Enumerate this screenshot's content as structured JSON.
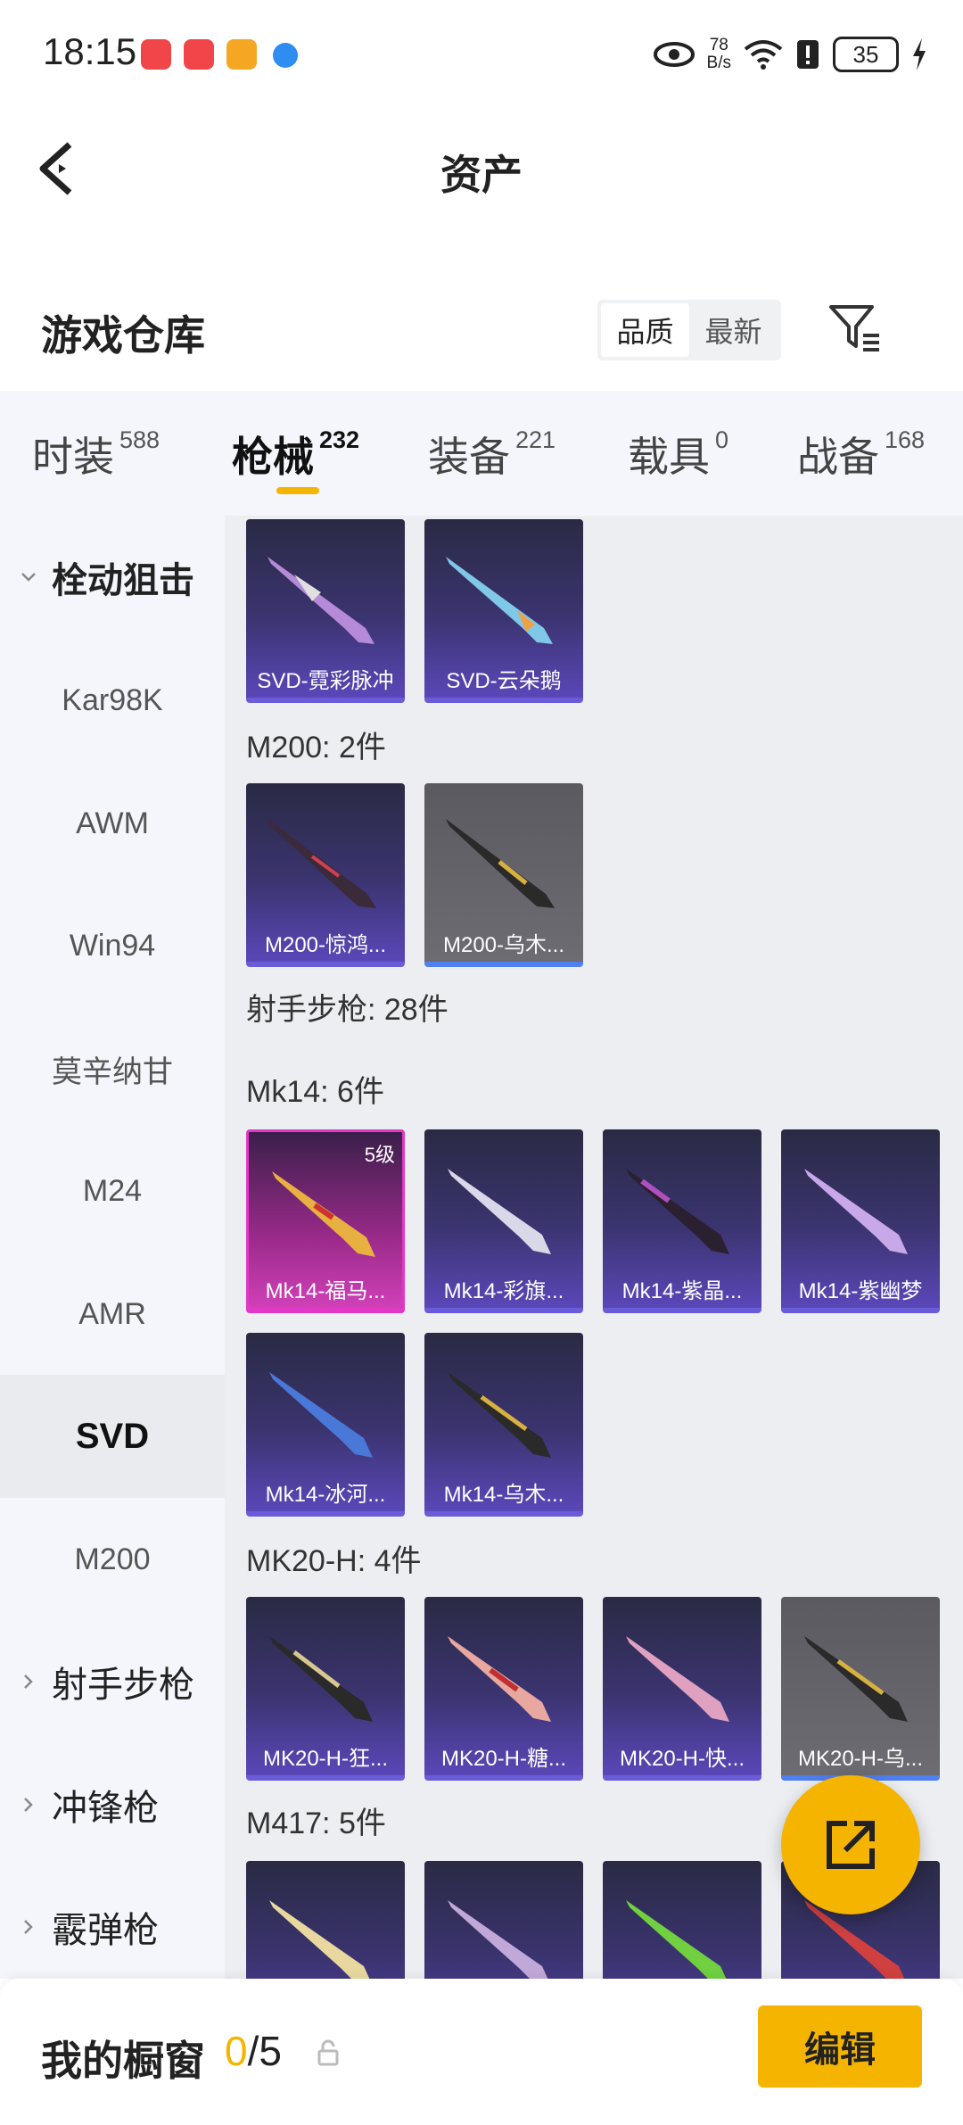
{
  "status_bar": {
    "time": "18:15",
    "net_speed_value": "78",
    "net_speed_unit": "B/s",
    "battery": "35"
  },
  "header": {
    "title": "资产",
    "back_icon": "back-chevron-icon"
  },
  "warehouse": {
    "title": "游戏仓库",
    "sort_options": [
      "品质",
      "最新"
    ],
    "sort_selected": "品质"
  },
  "tabs": [
    {
      "label": "时装",
      "count": "588"
    },
    {
      "label": "枪械",
      "count": "232"
    },
    {
      "label": "装备",
      "count": "221"
    },
    {
      "label": "载具",
      "count": "0"
    },
    {
      "label": "战备",
      "count": "168"
    }
  ],
  "sidebar": [
    {
      "label": "栓动狙击",
      "type": "group",
      "expanded": true
    },
    {
      "label": "Kar98K"
    },
    {
      "label": "AWM"
    },
    {
      "label": "Win94"
    },
    {
      "label": "莫辛纳甘"
    },
    {
      "label": "M24"
    },
    {
      "label": "AMR"
    },
    {
      "label": "SVD",
      "active": true
    },
    {
      "label": "M200"
    },
    {
      "label": "射手步枪",
      "type": "group"
    },
    {
      "label": "冲锋枪",
      "type": "group"
    },
    {
      "label": "霰弹枪",
      "type": "group"
    }
  ],
  "sections": {
    "m200": "M200: 2件",
    "marksman": "射手步枪: 28件",
    "mk14": "Mk14: 6件",
    "mk20": "MK20-H: 4件",
    "m417": "M417: 5件"
  },
  "cards": {
    "svd": [
      "SVD-霓彩脉冲",
      "SVD-云朵鹅"
    ],
    "m200": [
      "M200-惊鸿...",
      "M200-乌木..."
    ],
    "mk14": [
      "Mk14-福马...",
      "Mk14-彩旗...",
      "Mk14-紫晶...",
      "Mk14-紫幽梦",
      "Mk14-冰河...",
      "Mk14-乌木..."
    ],
    "mk14_badge": "5级",
    "mk20": [
      "MK20-H-狂...",
      "MK20-H-糖...",
      "MK20-H-快...",
      "MK20-H-乌..."
    ]
  },
  "bottom": {
    "label": "我的橱窗",
    "current": "0",
    "total": "/5",
    "edit": "编辑"
  },
  "colors": {
    "accent": "#f5b400",
    "purple_card": "#5a47b8",
    "pink_card": "#e238c8"
  }
}
